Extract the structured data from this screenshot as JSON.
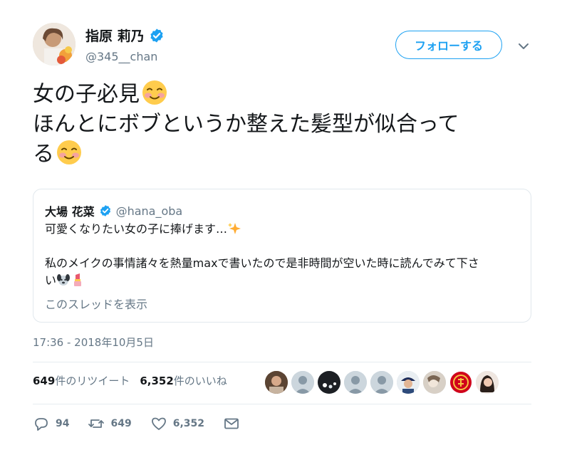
{
  "author": {
    "display_name": "指原 莉乃",
    "handle": "@345__chan",
    "verified": true
  },
  "follow_label": "フォローする",
  "tweet": {
    "lines": [
      "女の子必見",
      "ほんとにボブというか整えた髪型が似合って",
      "る"
    ],
    "emoji": "smiling-face-with-blush"
  },
  "quoted": {
    "display_name": "大場 花菜",
    "handle": "@hana_oba",
    "line1": "可愛くなりたい女の子に捧げます…",
    "line2": "私のメイクの事情諸々を熱量maxで書いたので是非時間が空いた時に読んでみて下さ",
    "line3": "い",
    "emojis": [
      "sparkles",
      "dog-face",
      "lipstick"
    ],
    "show_thread": "このスレッドを表示"
  },
  "timestamp": "17:36 - 2018年10月5日",
  "stats": {
    "retweets_num": "649",
    "retweets_label": "件のリツイート",
    "likes_num": "6,352",
    "likes_label": "件のいいね"
  },
  "actions": {
    "reply_count": "94",
    "retweet_count": "649",
    "like_count": "6,352"
  },
  "colors": {
    "accent": "#1da1f2",
    "muted": "#657786",
    "border": "#e1e8ed"
  }
}
